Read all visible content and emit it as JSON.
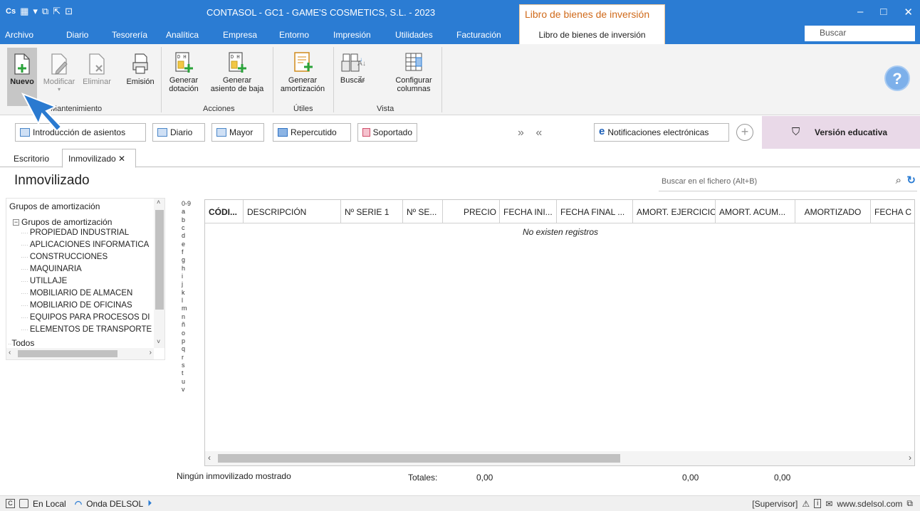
{
  "titlebar": {
    "app_title": "CONTASOL - GC1 - GAME'S COSMETICS, S.L. - 2023",
    "context_title": "Libro de bienes de inversión",
    "qat_icons": [
      "contasol-logo-icon",
      "calendar-icon",
      "open-icon",
      "export-icon",
      "lock-icon"
    ],
    "minimize": "–",
    "maximize": "□",
    "close": "✕"
  },
  "menu": {
    "items": [
      "Archivo",
      "Diario",
      "Tesorería",
      "Analítica",
      "Empresa",
      "Entorno",
      "Impresión",
      "Utilidades",
      "Facturación"
    ],
    "context_tab": "Libro de bienes de inversión",
    "search_placeholder": "Buscar"
  },
  "ribbon": {
    "nuevo": "Nuevo",
    "modificar": "Modificar",
    "eliminar": "Eliminar",
    "emision": "Emisión",
    "generar_dotacion_1": "Generar",
    "generar_dotacion_2": "dotación",
    "generar_baja_1": "Generar",
    "generar_baja_2": "asiento de baja",
    "generar_amort_1": "Generar",
    "generar_amort_2": "amortización",
    "buscar": "Buscar",
    "configurar_1": "Configurar",
    "configurar_2": "columnas",
    "group_mantenimiento": "Mantenimiento",
    "group_acciones": "Acciones",
    "group_utiles": "Útiles",
    "group_vista": "Vista"
  },
  "shortcuts": {
    "intro": "Introducción de asientos",
    "diario": "Diario",
    "mayor": "Mayor",
    "repercutido": "Repercutido",
    "soportado": "Soportado",
    "arrows": "» «",
    "notificaciones": "Notificaciones electrónicas",
    "version": "Versión educativa"
  },
  "tabs": {
    "escritorio": "Escritorio",
    "inmovilizado": "Inmovilizado ✕"
  },
  "page": {
    "title": "Inmovilizado",
    "search_file": "Buscar en el fichero (Alt+B)"
  },
  "tree": {
    "header": "Grupos de amortización",
    "root": "Grupos de amortización",
    "items": [
      "PROPIEDAD INDUSTRIAL",
      "APLICACIONES INFORMÁTICA",
      "CONSTRUCCIONES",
      "MAQUINARIA",
      "UTILLAJE",
      "MOBILIARIO DE ALMACÉN",
      "MOBILIARIO DE OFICINAS",
      "EQUIPOS PARA PROCESOS DI",
      "ELEMENTOS DE TRANSPORTE"
    ],
    "todos": "Todos"
  },
  "alphabet": [
    "0-9",
    "a",
    "b",
    "c",
    "d",
    "e",
    "f",
    "g",
    "h",
    "i",
    "j",
    "k",
    "l",
    "m",
    "n",
    "ñ",
    "o",
    "p",
    "q",
    "r",
    "s",
    "t",
    "u",
    "v"
  ],
  "grid": {
    "columns": [
      "CÓDI...",
      "DESCRIPCIÓN",
      "Nº SERIE 1",
      "Nº SE...",
      "PRECIO",
      "FECHA INI...",
      "FECHA FINAL ...",
      "AMORT. EJERCICIO",
      "AMORT. ACUM...",
      "AMORTIZADO",
      "FECHA C"
    ],
    "empty_message": "No existen registros"
  },
  "footer": {
    "label": "Ningún inmovilizado mostrado",
    "totales": "Totales:",
    "precio_total": "0,00",
    "amort_ejercicio_total": "0,00",
    "amort_acum_total": "0,00"
  },
  "statusbar": {
    "en_local": "En Local",
    "onda": "Onda DELSOL",
    "supervisor": "[Supervisor]",
    "website": "www.sdelsol.com"
  },
  "colors": {
    "accent": "#2b7cd3",
    "context": "#d06a1a",
    "edu_bg": "#e9d9e8",
    "cursor": "#2a7ad0"
  }
}
